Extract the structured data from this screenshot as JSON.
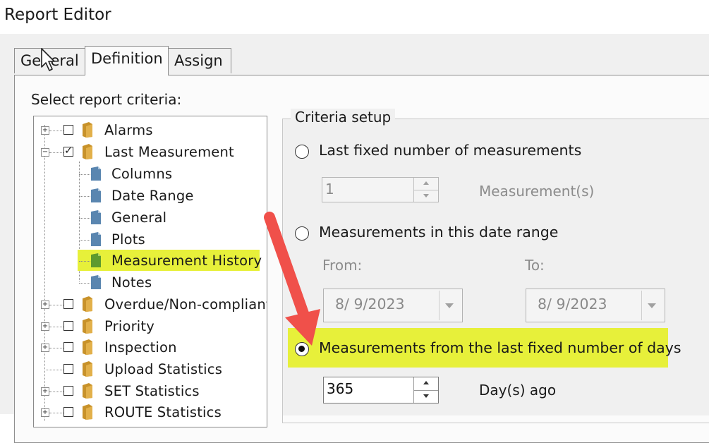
{
  "window": {
    "title": "Report Editor"
  },
  "tabs": [
    {
      "label": "General",
      "active": false
    },
    {
      "label": "Definition",
      "active": true
    },
    {
      "label": "Assign",
      "active": false
    }
  ],
  "criteria_label": "Select report criteria:",
  "tree": [
    {
      "label": "Alarms",
      "type": "folder",
      "checked": false,
      "expander": "+"
    },
    {
      "label": "Last Measurement",
      "type": "folder",
      "checked": true,
      "expander": "−"
    },
    {
      "label": "Columns",
      "type": "page"
    },
    {
      "label": "Date Range",
      "type": "page"
    },
    {
      "label": "General",
      "type": "page"
    },
    {
      "label": "Plots",
      "type": "page"
    },
    {
      "label": "Measurement History",
      "type": "page",
      "selected": true
    },
    {
      "label": "Notes",
      "type": "page"
    },
    {
      "label": "Overdue/Non-compliant",
      "type": "folder",
      "checked": false,
      "expander": "+"
    },
    {
      "label": "Priority",
      "type": "folder",
      "checked": false,
      "expander": "+"
    },
    {
      "label": "Inspection",
      "type": "folder",
      "checked": false,
      "expander": "+"
    },
    {
      "label": "Upload Statistics",
      "type": "folder",
      "checked": false,
      "expander": ""
    },
    {
      "label": "SET Statistics",
      "type": "folder",
      "checked": false,
      "expander": "+"
    },
    {
      "label": "ROUTE Statistics",
      "type": "folder",
      "checked": false,
      "expander": "+"
    }
  ],
  "criteria_setup": {
    "legend": "Criteria setup",
    "option_fixed_count": {
      "label": "Last fixed number of measurements",
      "selected": false
    },
    "fixed_count_value": "1",
    "fixed_count_unit": "Measurement(s)",
    "option_date_range": {
      "label": "Measurements in this date range",
      "selected": false
    },
    "from_label": "From:",
    "from_value": "8/  9/2023",
    "to_label": "To:",
    "to_value": "8/  9/2023",
    "option_days": {
      "label": "Measurements from the last fixed number of days",
      "selected": true
    },
    "days_value": "365",
    "days_unit": "Day(s) ago"
  },
  "colors": {
    "highlight": "#e7f03a",
    "arrow": "#f0504a",
    "dialog_bg": "#f0f0f0",
    "folder": "#c8922a",
    "page": "#5a86b0",
    "page_selected": "#5f9a2e"
  },
  "icons": {
    "folder": "folder-icon",
    "page": "page-icon",
    "cursor": "mouse-pointer-icon",
    "annotation": "red-arrow-icon"
  }
}
